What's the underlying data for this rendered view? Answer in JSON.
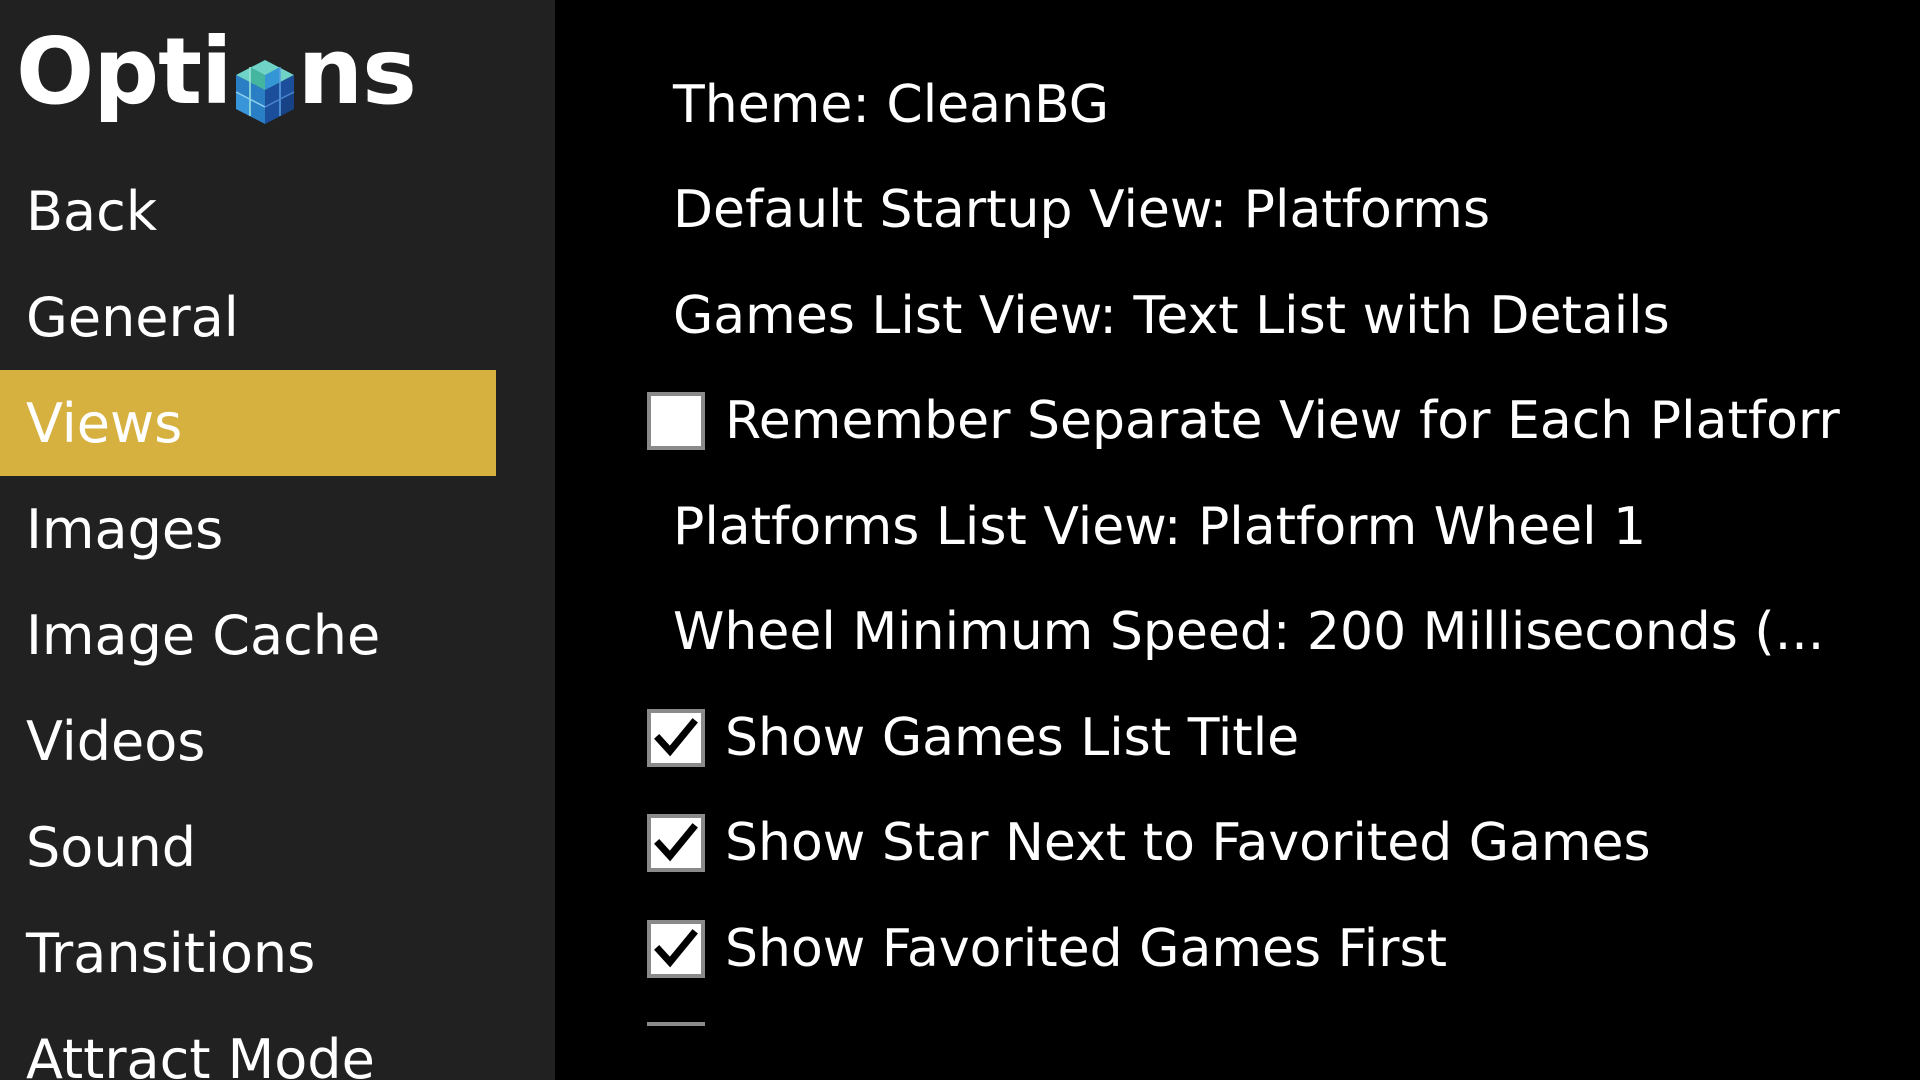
{
  "window": {
    "title": "Options"
  },
  "sidebar": {
    "logo_text_left": "Opti",
    "logo_text_right": "ns",
    "logo_icon": "cube-icon",
    "items": [
      {
        "label": "Back",
        "selected": false
      },
      {
        "label": "General",
        "selected": false
      },
      {
        "label": "Views",
        "selected": true
      },
      {
        "label": "Images",
        "selected": false
      },
      {
        "label": "Image Cache",
        "selected": false
      },
      {
        "label": "Videos",
        "selected": false
      },
      {
        "label": "Sound",
        "selected": false
      },
      {
        "label": "Transitions",
        "selected": false
      },
      {
        "label": "Attract Mode",
        "selected": false
      }
    ]
  },
  "options": {
    "theme": "Theme: CleanBG",
    "default_startup_view": "Default Startup View: Platforms",
    "games_list_view": "Games List View: Text List with Details",
    "remember_separate_view": {
      "label": "Remember Separate View for Each Platforr",
      "checked": false
    },
    "platforms_list_view": "Platforms List View: Platform Wheel 1",
    "wheel_minimum_speed": "Wheel Minimum Speed: 200 Milliseconds (...",
    "show_games_list_title": {
      "label": "Show Games List Title",
      "checked": true
    },
    "show_star_favorited": {
      "label": "Show Star Next to Favorited Games",
      "checked": true
    },
    "show_favorited_first": {
      "label": "Show Favorited Games First",
      "checked": true
    },
    "next_item_partial": {
      "label": "",
      "checked": true
    }
  },
  "colors": {
    "sidebar_bg": "#212121",
    "main_bg": "#000000",
    "selected_bg": "#d6b140",
    "text": "#ffffff"
  }
}
